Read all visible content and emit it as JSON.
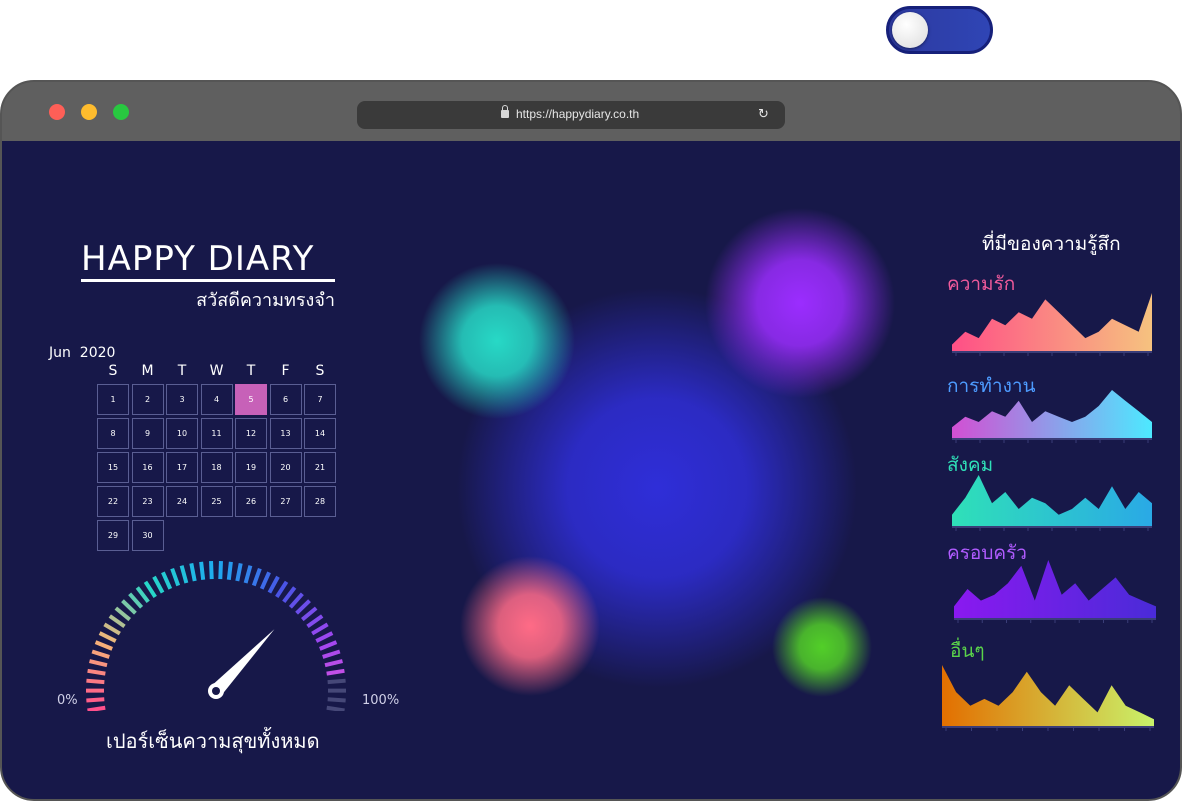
{
  "toggle": {
    "state": "on"
  },
  "browser": {
    "url": "https://happydiary.co.th",
    "reload_icon": "reload-icon",
    "lock_icon": "lock-icon",
    "traffic_lights": [
      "#fe5f57",
      "#febc2e",
      "#28c840"
    ]
  },
  "brand": {
    "title": "HAPPY DIARY",
    "subtitle": "สวัสดีความทรงจำ"
  },
  "calendar": {
    "month": "Jun",
    "year": "2020",
    "weekdays": [
      "S",
      "M",
      "T",
      "W",
      "T",
      "F",
      "S"
    ],
    "selected_day": "5",
    "selected_color": "#c761b8",
    "weeks": [
      [
        "1",
        "2",
        "3",
        "4",
        "5",
        "6",
        "7"
      ],
      [
        "8",
        "9",
        "10",
        "11",
        "12",
        "13",
        "14"
      ],
      [
        "15",
        "16",
        "17",
        "18",
        "19",
        "20",
        "21"
      ],
      [
        "22",
        "23",
        "24",
        "25",
        "26",
        "27",
        "28"
      ],
      [
        "29",
        "30"
      ]
    ]
  },
  "gauge": {
    "min_label": "0%",
    "max_label": "100%",
    "label": "เปอร์เซ็นความสุขทั้งหมด",
    "value": 0.72
  },
  "emotions": {
    "title": "ที่มีของความรู้สึก",
    "categories": [
      {
        "label": "ความรัก",
        "color": "#ef5a9b",
        "gradient": [
          "#ff4f86",
          "#f6c27f"
        ],
        "values": [
          1,
          3,
          2,
          5,
          4,
          6,
          5,
          8,
          6,
          4,
          2,
          3,
          5,
          4,
          3,
          9
        ]
      },
      {
        "label": "การทำงาน",
        "color": "#4d9bff",
        "gradient": [
          "#d24fd3",
          "#4de9ff"
        ],
        "values": [
          2,
          4,
          3,
          5,
          4,
          7,
          3,
          5,
          4,
          3,
          4,
          6,
          9,
          7,
          5,
          3
        ]
      },
      {
        "label": "สังคม",
        "color": "#2fe0b8",
        "gradient": [
          "#2fe0b8",
          "#2aa9e6"
        ],
        "values": [
          2,
          5,
          9,
          4,
          6,
          3,
          5,
          4,
          2,
          3,
          5,
          3,
          7,
          3,
          6,
          4
        ]
      },
      {
        "label": "ครอบครัว",
        "color": "#b05bff",
        "gradient": [
          "#8a19f0",
          "#4a2bd8"
        ],
        "values": [
          2,
          5,
          3,
          4,
          6,
          9,
          3,
          10,
          4,
          6,
          3,
          5,
          7,
          4,
          3,
          2
        ]
      },
      {
        "label": "อื่นๆ",
        "color": "#5ad34a",
        "gradient": [
          "#e36f00",
          "#c9f26a"
        ],
        "values": [
          9,
          5,
          3,
          4,
          3,
          5,
          8,
          5,
          3,
          6,
          4,
          2,
          6,
          3,
          2,
          1
        ]
      }
    ]
  },
  "blobs": {
    "colors": [
      "#27d9c6",
      "#9b2dff",
      "#2f2ed8",
      "#ff6b86",
      "#52cf28"
    ]
  }
}
